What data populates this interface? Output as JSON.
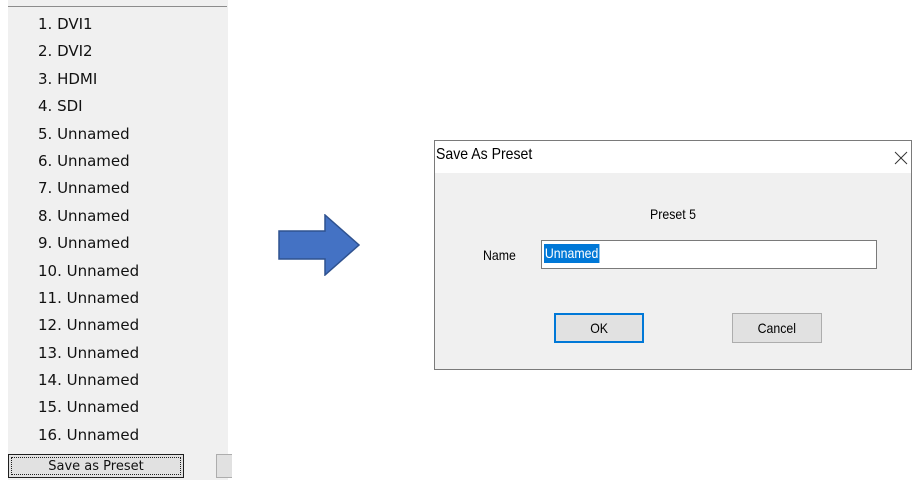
{
  "preset_list": {
    "items": [
      "1. DVI1",
      "2. DVI2",
      "3. HDMI",
      "4. SDI",
      "5. Unnamed",
      "6. Unnamed",
      "7. Unnamed",
      "8. Unnamed",
      "9. Unnamed",
      "10. Unnamed",
      "11. Unnamed",
      "12. Unnamed",
      "13. Unnamed",
      "14. Unnamed",
      "15. Unnamed",
      "16. Unnamed"
    ],
    "save_button_label": "Save as Preset"
  },
  "arrow": {
    "icon": "right-arrow-icon",
    "fill_color": "#4472c4",
    "stroke_color": "#2f528f"
  },
  "dialog": {
    "title": "Save As Preset",
    "close_icon": "close-icon",
    "preset_heading": "Preset 5",
    "name_label": "Name",
    "name_value": "Unnamed",
    "ok_label": "OK",
    "cancel_label": "Cancel",
    "accent_color": "#0078d7"
  }
}
